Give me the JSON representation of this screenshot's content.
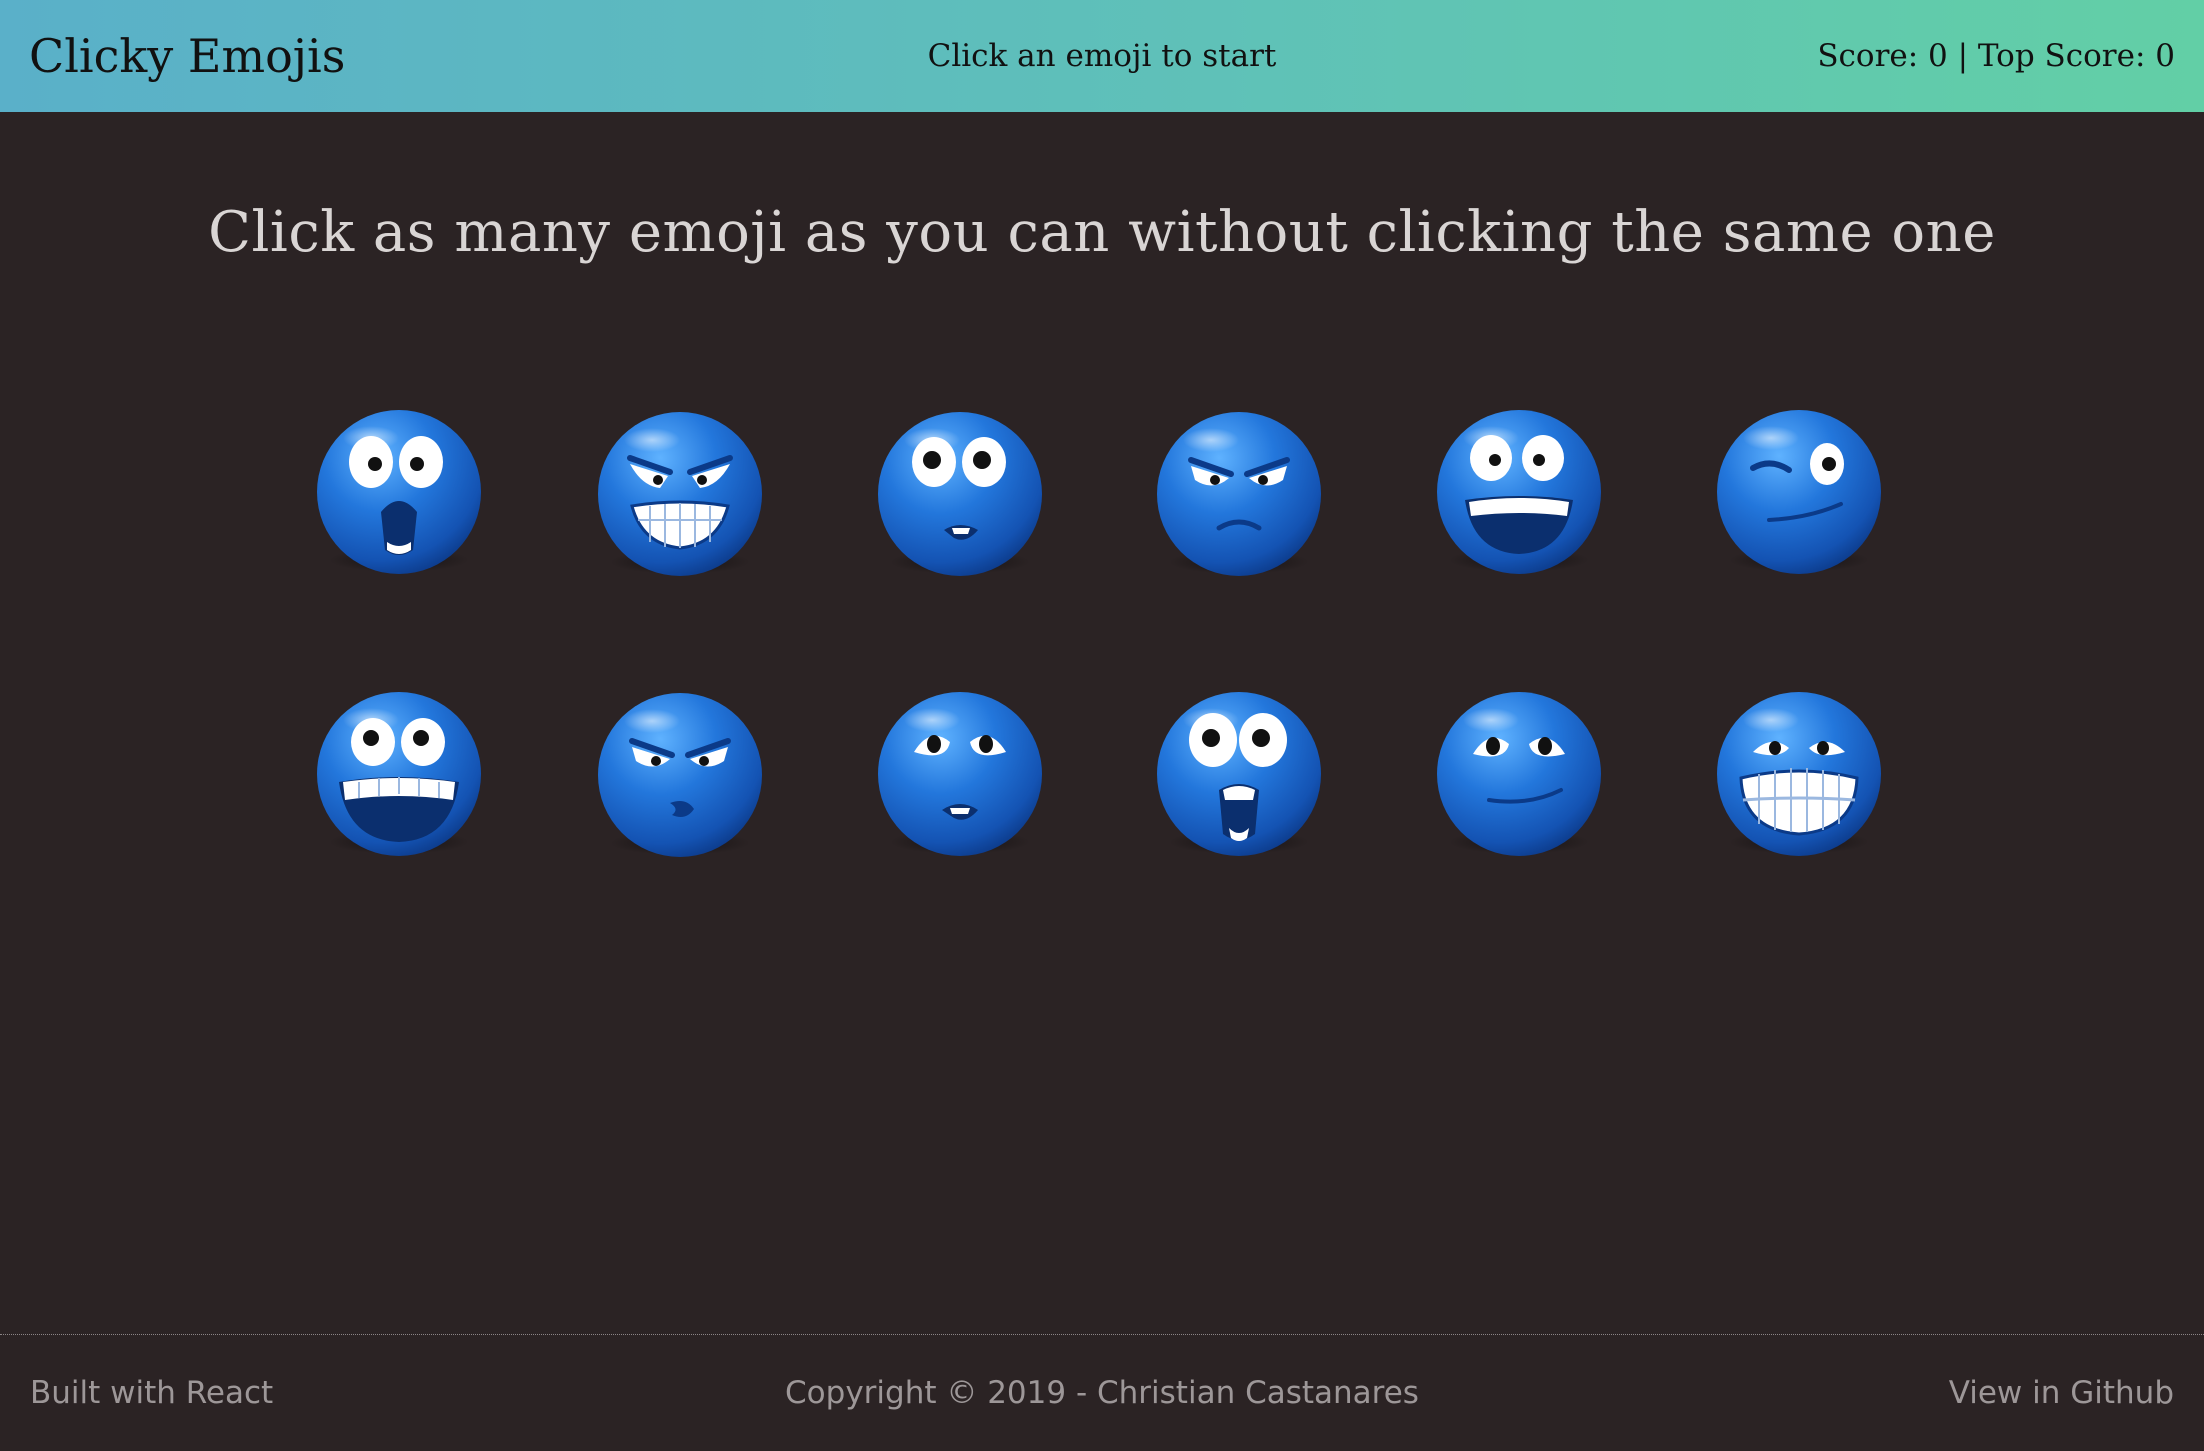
{
  "navbar": {
    "brand": "Clicky Emojis",
    "status": "Click an emoji to start",
    "score_text": "Score: 0 | Top Score: 0",
    "gradient_colors": [
      "#5ab0c9",
      "#62cfa6"
    ]
  },
  "main": {
    "instructions": "Click as many emoji as you can without clicking the same one",
    "background_color": "#2b2324",
    "emojis": [
      {
        "name": "shocked-emoji",
        "expression": "shocked"
      },
      {
        "name": "angry-grin-emoji",
        "expression": "angry-grin"
      },
      {
        "name": "nervous-lip-bite-emoji",
        "expression": "nervous-lip-bite"
      },
      {
        "name": "angry-frown-emoji",
        "expression": "angry-frown"
      },
      {
        "name": "big-grin-emoji",
        "expression": "big-grin"
      },
      {
        "name": "wink-emoji",
        "expression": "wink"
      },
      {
        "name": "laughing-emoji",
        "expression": "laughing"
      },
      {
        "name": "angry-pout-emoji",
        "expression": "angry-pout"
      },
      {
        "name": "worried-lip-bite-emoji",
        "expression": "worried-lip-bite"
      },
      {
        "name": "screaming-emoji",
        "expression": "screaming"
      },
      {
        "name": "smirk-emoji",
        "expression": "smirk"
      },
      {
        "name": "grimace-emoji",
        "expression": "grimace"
      }
    ]
  },
  "footer": {
    "left": "Built with React",
    "center": "Copyright © 2019 - Christian Castanares",
    "right": "View in Github"
  }
}
